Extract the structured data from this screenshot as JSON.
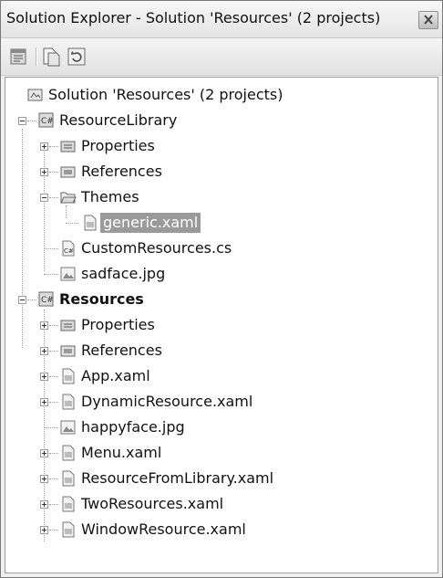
{
  "window": {
    "title": "Solution Explorer - Solution 'Resources' (2 projects)",
    "close_icon": "close-icon"
  },
  "toolbar": {
    "buttons": [
      {
        "name": "properties-button",
        "icon": "properties-icon"
      },
      {
        "name": "show-all-files-button",
        "icon": "show-all-files-icon"
      },
      {
        "name": "refresh-button",
        "icon": "refresh-icon"
      }
    ]
  },
  "tree": {
    "solution": "Solution 'Resources' (2 projects)",
    "resource_library": {
      "label": "ResourceLibrary",
      "properties": "Properties",
      "references": "References",
      "themes": "Themes",
      "generic_xaml": "generic.xaml",
      "custom_resources": "CustomResources.cs",
      "sadface": "sadface.jpg"
    },
    "resources": {
      "label": "Resources",
      "properties": "Properties",
      "references": "References",
      "app_xaml": "App.xaml",
      "dynamic_resource": "DynamicResource.xaml",
      "happyface": "happyface.jpg",
      "menu_xaml": "Menu.xaml",
      "resource_from_library": "ResourceFromLibrary.xaml",
      "two_resources": "TwoResources.xaml",
      "window_resource": "WindowResource.xaml"
    }
  }
}
